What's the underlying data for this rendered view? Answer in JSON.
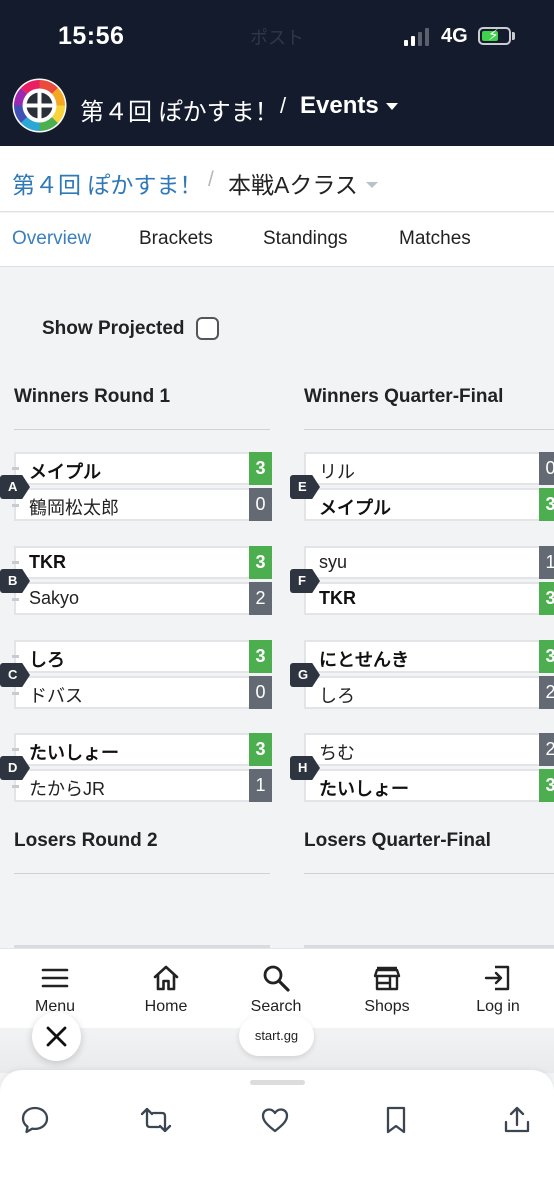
{
  "status_bar": {
    "time": "15:56",
    "faded_title": "ポスト",
    "network": "4G"
  },
  "header": {
    "title": "第４回 ぽかすま！",
    "separator": "/",
    "events_label": "Events"
  },
  "breadcrumb": {
    "tournament": "第４回 ぽかすま！",
    "separator": "/",
    "event": "本戦Aクラス"
  },
  "tabs": [
    {
      "label": "Overview",
      "active": true
    },
    {
      "label": "Brackets",
      "active": false
    },
    {
      "label": "Standings",
      "active": false
    },
    {
      "label": "Matches",
      "active": false
    }
  ],
  "show_projected": {
    "label": "Show Projected",
    "checked": false
  },
  "rounds": {
    "winners_r1": "Winners Round 1",
    "winners_qf": "Winners Quarter-Final",
    "losers_r2": "Losers Round 2",
    "losers_qf": "Losers Quarter-Final"
  },
  "matches_left": [
    {
      "id": "A",
      "p1": {
        "name": "メイプル",
        "score": "3",
        "win": true
      },
      "p2": {
        "name": "鶴岡松太郎",
        "score": "0",
        "win": false
      }
    },
    {
      "id": "B",
      "p1": {
        "name": "TKR",
        "score": "3",
        "win": true
      },
      "p2": {
        "name": "Sakyo",
        "score": "2",
        "win": false
      }
    },
    {
      "id": "C",
      "p1": {
        "name": "しろ",
        "score": "3",
        "win": true
      },
      "p2": {
        "name": "ドバス",
        "score": "0",
        "win": false
      }
    },
    {
      "id": "D",
      "p1": {
        "name": "たいしょー",
        "score": "3",
        "win": true
      },
      "p2": {
        "name": "たからJR",
        "score": "1",
        "win": false
      }
    }
  ],
  "matches_right": [
    {
      "id": "E",
      "p1": {
        "name": "リル",
        "score": "0",
        "win": false
      },
      "p2": {
        "name": "メイプル",
        "score": "3",
        "win": true
      }
    },
    {
      "id": "F",
      "p1": {
        "name": "syu",
        "score": "1",
        "win": false
      },
      "p2": {
        "name": "TKR",
        "score": "3",
        "win": true
      }
    },
    {
      "id": "G",
      "p1": {
        "name": "にとせんき",
        "score": "3",
        "win": true
      },
      "p2": {
        "name": "しろ",
        "score": "2",
        "win": false
      }
    },
    {
      "id": "H",
      "p1": {
        "name": "ちむ",
        "score": "2",
        "win": false
      },
      "p2": {
        "name": "たいしょー",
        "score": "3",
        "win": true
      }
    }
  ],
  "bottom_nav": [
    {
      "label": "Menu",
      "icon": "menu-icon"
    },
    {
      "label": "Home",
      "icon": "home-icon"
    },
    {
      "label": "Search",
      "icon": "search-icon"
    },
    {
      "label": "Shops",
      "icon": "shop-icon"
    },
    {
      "label": "Log in",
      "icon": "login-icon"
    }
  ],
  "browser": {
    "url": "start.gg"
  },
  "colors": {
    "header_bg": "#141b2d",
    "link": "#2f79b8",
    "active_tab": "#3a7fc1",
    "win": "#4cae4f",
    "lose": "#636a73"
  },
  "share_bar_icons": [
    "reply-icon",
    "repost-icon",
    "like-icon",
    "bookmark-icon",
    "share-icon"
  ]
}
